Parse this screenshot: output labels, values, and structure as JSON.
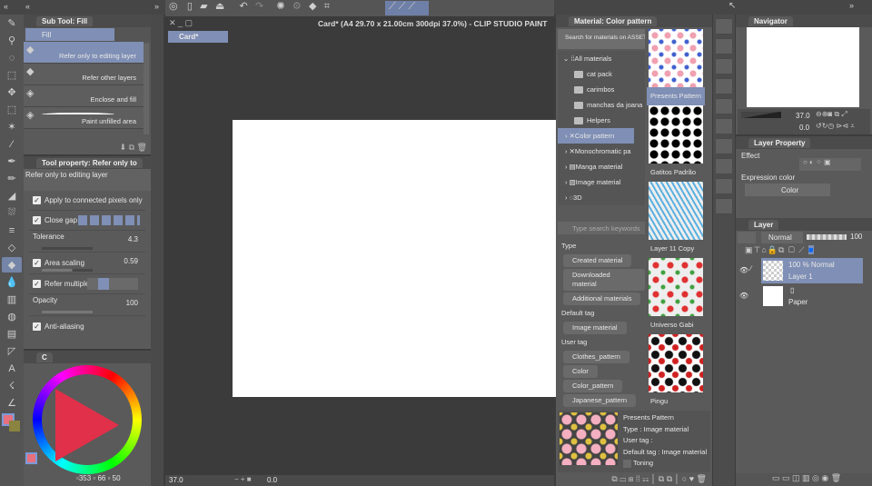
{
  "window": {
    "title": "Card* (A4 29.70 x 21.00cm 300dpi 37.0%)  - CLIP STUDIO PAINT",
    "doc_tab": "Card*"
  },
  "subtool": {
    "header": "Sub Tool: Fill",
    "group": "Fill",
    "items": [
      "Refer only to editing layer",
      "Refer other layers",
      "Enclose and fill",
      "Paint unfilled area"
    ]
  },
  "toolprop": {
    "header": "Tool property: Refer only to",
    "preset": "Refer only to editing layer",
    "apply": "Apply to connected pixels only",
    "close_gap": "Close gap",
    "tolerance": "Tolerance",
    "tolerance_val": "4.3",
    "area_scaling": "Area scaling",
    "area_val": "0.59",
    "refer_multiple": "Refer multiple",
    "opacity": "Opacity",
    "opacity_val": "100",
    "antialias": "Anti-aliasing"
  },
  "color": {
    "tab": "C",
    "h": "353",
    "s": "66",
    "v": "50",
    "main": "#e8707e",
    "sub": "#8a8440"
  },
  "status": {
    "zoom": "37.0",
    "angle": "0.0"
  },
  "material": {
    "header": "Material: Color pattern",
    "search_assets": "Search for materials on ASSETS",
    "tree": [
      "All materials",
      "cat pack",
      "carimbos",
      "manchas da joana",
      "Helpers",
      "Color pattern",
      "Monochromatic pa",
      "Manga material",
      "Image material",
      "3D"
    ],
    "thumbs": [
      "Presents Pattern",
      "Gatitos Padrão",
      "Layer 11 Copy",
      "Universo Gabi",
      "Pingu"
    ],
    "search_placeholder": "Type search keywords",
    "type_label": "Type",
    "types": [
      "Created material",
      "Downloaded material",
      "Additional materials"
    ],
    "default_tag_label": "Default tag",
    "default_tags": [
      "Image material"
    ],
    "user_tag_label": "User tag",
    "user_tags": [
      "Clothes_pattern",
      "Color",
      "Color_pattern",
      "Japanese_pattern"
    ],
    "detail": {
      "name": "Presents Pattern",
      "type": "Type : Image material",
      "user_tag": "User tag :",
      "default_tag": "Default tag : Image material",
      "toning": "Toning"
    }
  },
  "navigator": {
    "tab": "Navigator",
    "zoom": "37.0",
    "angle": "0.0"
  },
  "layer_prop": {
    "tab": "Layer Property",
    "effect": "Effect",
    "expression_color": "Expression color",
    "color_value": "Color"
  },
  "layers": {
    "tab": "Layer",
    "blend": "Normal",
    "opacity": "100",
    "items": [
      {
        "info": "100 %  Normal",
        "name": "Layer 1"
      },
      {
        "info": "",
        "name": "Paper"
      }
    ]
  }
}
